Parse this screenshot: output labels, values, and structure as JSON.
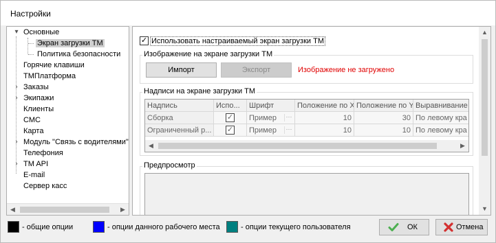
{
  "window": {
    "title": "Настройки"
  },
  "tree": {
    "items": [
      {
        "label": "Основные",
        "expander": "▾"
      },
      {
        "label": "Экран загрузки ТМ"
      },
      {
        "label": "Политика безопасности"
      },
      {
        "label": "Горячие клавиши"
      },
      {
        "label": "ТМПлатформа"
      },
      {
        "label": "Заказы",
        "expander": "›"
      },
      {
        "label": "Экипажи",
        "expander": "›"
      },
      {
        "label": "Клиенты"
      },
      {
        "label": "СМС"
      },
      {
        "label": "Карта"
      },
      {
        "label": "Модуль \"Связь с водителями\"",
        "expander": "›"
      },
      {
        "label": "Телефония"
      },
      {
        "label": "TM API",
        "expander": "›"
      },
      {
        "label": "E-mail"
      },
      {
        "label": "Сервер касс"
      }
    ]
  },
  "panel": {
    "use_custom_checkbox": {
      "label": "Использовать настраиваемый экран загрузки ТМ",
      "checked": "✓"
    },
    "image_group": {
      "title": "Изображение на экране загрузки ТМ",
      "import_label": "Импорт",
      "export_label": "Экспорт",
      "status": "Изображение не загружено"
    },
    "captions_group": {
      "title": "Надписи на экране загрузки ТМ",
      "columns": [
        "Надпись",
        "Испо...",
        "Шрифт",
        "Положение по X",
        "Положение по Y",
        "Выравнивание"
      ],
      "rows": [
        {
          "caption": "Сборка",
          "used": "✓",
          "font": "Пример",
          "dots": "···",
          "x": "10",
          "y": "30",
          "align": "По левому кра"
        },
        {
          "caption": "Ограниченный р...",
          "used": "✓",
          "font": "Пример",
          "dots": "···",
          "x": "10",
          "y": "10",
          "align": "По левому кра"
        }
      ]
    },
    "preview_group": {
      "title": "Предпросмотр"
    }
  },
  "legend": [
    {
      "label": "- общие опции",
      "color": "#000000"
    },
    {
      "label": "- опции данного рабочего места",
      "color": "#0000ff"
    },
    {
      "label": "- опции текущего пользователя",
      "color": "#008080"
    }
  ],
  "buttons": {
    "ok_label": "ОК",
    "cancel_label": "Отмена"
  },
  "colors": {
    "error_text": "#e00000",
    "ok_icon": "#4caf50",
    "cancel_icon": "#d32f2f"
  }
}
